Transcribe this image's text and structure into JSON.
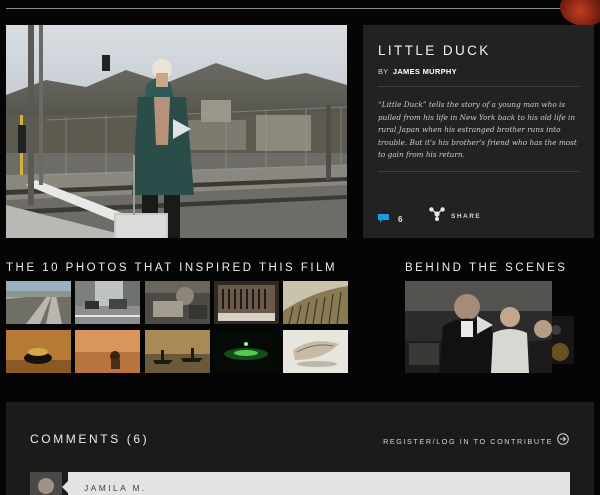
{
  "film": {
    "title": "LITTLE DUCK",
    "by_prefix": "BY",
    "author": "JAMES MURPHY",
    "description": "“Little Duck” tells the story of a young man who is pulled from his life in New York back to his old life in rural Japan when his estranged brother runs into trouble. But it's his brother's friend who has the most to gain from his return.",
    "comment_count": "6",
    "share_label": "SHARE"
  },
  "photos_section": {
    "heading": "THE 10 PHOTOS THAT INSPIRED THIS FILM",
    "thumbs": [
      {
        "name": "rail-tracks"
      },
      {
        "name": "city-street"
      },
      {
        "name": "cafe-interior"
      },
      {
        "name": "audio-mixer"
      },
      {
        "name": "fence-snow"
      },
      {
        "name": "dark-object"
      },
      {
        "name": "desert-figure"
      },
      {
        "name": "boat-river"
      },
      {
        "name": "green-lights"
      },
      {
        "name": "white-object"
      }
    ]
  },
  "bts_section": {
    "heading": "BEHIND THE SCENES"
  },
  "comments": {
    "title": "COMMENTS (6)",
    "register_label": "REGISTER/LOG IN TO CONTRIBUTE",
    "first_author": "JAMILA M."
  },
  "colors": {
    "background": "#050505",
    "panel": "#222222",
    "accent_blue": "#1e9be0"
  },
  "icons": {
    "comment": "speech-bubble-icon",
    "share": "share-network-icon",
    "play": "play-icon",
    "register": "arrow-circle-right-icon"
  }
}
